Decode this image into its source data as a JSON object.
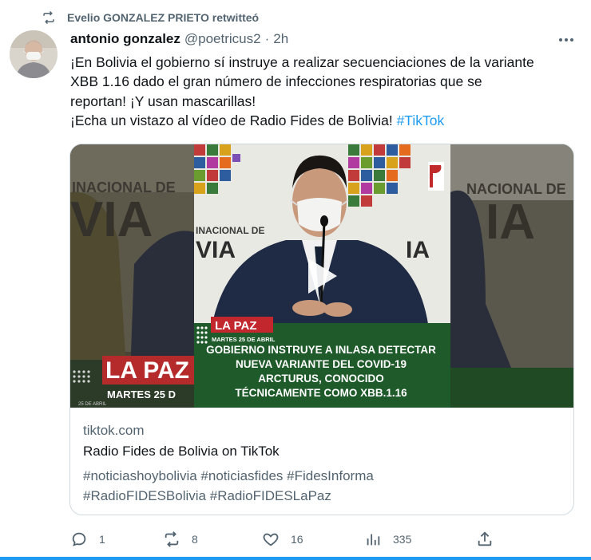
{
  "retweet": {
    "text": "Evelio GONZALEZ PRIETO retwitteó"
  },
  "author": {
    "name": "antonio gonzalez",
    "handle": "@poetricus2",
    "separator": "·",
    "time": "2h"
  },
  "tweet": {
    "line1": "¡En Bolivia el gobierno sí instruye a realizar secuenciaciones de la variante",
    "line2": "XBB 1.16  dado el gran número de infecciones respiratorias que se",
    "line3": "reportan! ¡Y usan mascarillas!",
    "line4": "¡Echa un vistazo al vídeo de Radio Fides de Bolivia!",
    "hashtag": "#TikTok"
  },
  "video": {
    "bg_left_text": "INACIONAL DE",
    "bg_left_big": "VIA",
    "bg_right_text": "NACIONAL DE",
    "bg_right_big": "IA",
    "bg_lapaz": "LA PAZ",
    "bg_martes": "MARTES 25 D",
    "center_inst": "INACIONAL DE",
    "center_big_left": "VIA",
    "center_big_right": "IA",
    "lower_city": "LA PAZ",
    "lower_date": "MARTES 25  DE ABRIL",
    "lower_line1": "GOBIERNO INSTRUYE A INLASA DETECTAR",
    "lower_line2": "NUEVA VARIANTE DEL COVID-19",
    "lower_line3": "ARCTURUS, CONOCIDO",
    "lower_line4": "TÉCNICAMENTE COMO XBB.1.16",
    "corner_stamp": "25 DE ABRIL"
  },
  "card": {
    "domain": "tiktok.com",
    "title": "Radio Fides de Bolivia on TikTok",
    "desc_line1": "#noticiashoybolivia #noticiasfides #FidesInforma",
    "desc_line2": "#RadioFIDESBolivia #RadioFIDESLaPaz"
  },
  "actions": {
    "replies": "1",
    "retweets": "8",
    "likes": "16",
    "views": "335"
  },
  "colors": {
    "accent": "#1d9bf0",
    "muted": "#536471",
    "green_banner": "#1f5b2a",
    "red_banner": "#c1272d"
  },
  "icons": [
    "retweet-icon",
    "more-icon",
    "play-icon",
    "reply-icon",
    "like-icon",
    "views-icon",
    "share-icon"
  ]
}
